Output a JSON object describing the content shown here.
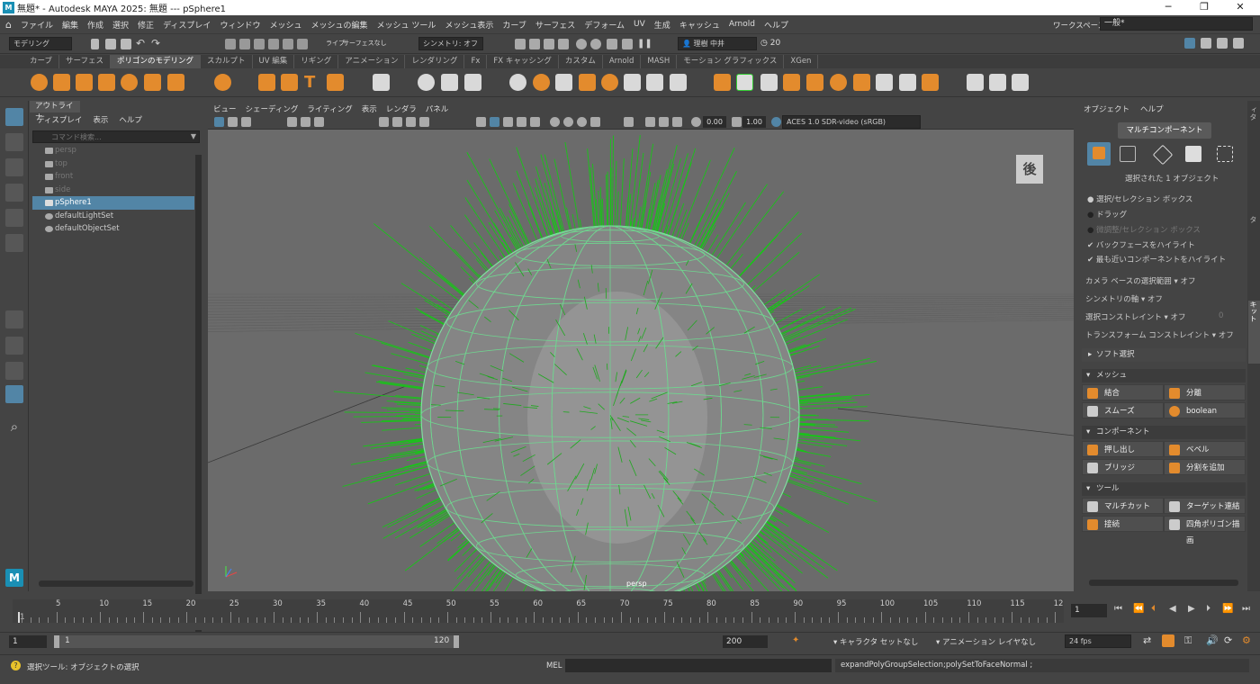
{
  "window": {
    "title": "無題* - Autodesk MAYA 2025: 無題   ---   pSphere1",
    "min": "─",
    "max": "❐",
    "close": "✕"
  },
  "menu": [
    "ファイル",
    "編集",
    "作成",
    "選択",
    "修正",
    "ディスプレイ",
    "ウィンドウ",
    "メッシュ",
    "メッシュの編集",
    "メッシュ ツール",
    "メッシュ表示",
    "カーブ",
    "サーフェス",
    "デフォーム",
    "UV",
    "生成",
    "キャッシュ",
    "Arnold",
    "ヘルプ"
  ],
  "workspace": {
    "label": "ワークスペース:",
    "value": "一般*"
  },
  "status": {
    "mode": "モデリング",
    "live": "ライブ",
    "live_value": "サーフェスなし",
    "symmetry": "シンメトリ: オフ",
    "user": "理樹 中井",
    "notifications": "20"
  },
  "shelf_tabs": [
    "カーブ",
    "サーフェス",
    "ポリゴンのモデリング",
    "スカルプト",
    "UV 編集",
    "リギング",
    "アニメーション",
    "レンダリング",
    "Fx",
    "FX キャッシング",
    "カスタム",
    "Arnold",
    "MASH",
    "モーション グラフィックス",
    "XGen"
  ],
  "shelf_active": "ポリゴンのモデリング",
  "outliner": {
    "title": "アウトライナ",
    "menu": [
      "ディスプレイ",
      "表示",
      "ヘルプ"
    ],
    "search_placeholder": "コマンド検索...",
    "items": [
      {
        "label": "persp",
        "state": "dim"
      },
      {
        "label": "top",
        "state": "dim"
      },
      {
        "label": "front",
        "state": "dim"
      },
      {
        "label": "side",
        "state": "dim"
      },
      {
        "label": "pSphere1",
        "state": "sel"
      },
      {
        "label": "defaultLightSet",
        "state": "normal"
      },
      {
        "label": "defaultObjectSet",
        "state": "normal"
      }
    ]
  },
  "viewport": {
    "menu": [
      "ビュー",
      "シェーディング",
      "ライティング",
      "表示",
      "レンダラ",
      "パネル"
    ],
    "exposure": "0.00",
    "gamma": "1.00",
    "colorspace": "ACES 1.0 SDR-video (sRGB)",
    "camera_label": "persp",
    "viewcube_label": "後"
  },
  "tool_settings": {
    "menu": [
      "オブジェクト",
      "ヘルプ"
    ],
    "multi_component": "マルチコンポーネント",
    "selected_count": "選択された 1 オブジェクト",
    "options": [
      "選択/セレクション ボックス",
      "ドラッグ",
      "微調整/セレクション ボックス"
    ],
    "checks": [
      "バックフェースをハイライト",
      "最も近いコンポーネントをハイライト"
    ],
    "dropdowns": [
      {
        "label": "カメラ ベースの選択範囲",
        "value": "オフ"
      },
      {
        "label": "シンメトリの軸",
        "value": "オフ"
      },
      {
        "label": "選択コンストレイント",
        "value": "オフ",
        "extra": "0"
      },
      {
        "label": "トランスフォーム コンストレイント",
        "value": "オフ"
      }
    ],
    "soft_select": "ソフト選択",
    "sections": [
      {
        "title": "メッシュ",
        "buttons": [
          "結合",
          "分離",
          "スムーズ",
          "boolean"
        ]
      },
      {
        "title": "コンポーネント",
        "buttons": [
          "押し出し",
          "ベベル",
          "ブリッジ",
          "分割を追加"
        ]
      },
      {
        "title": "ツール",
        "buttons": [
          "マルチカット",
          "ターゲット連結",
          "接続",
          "四角ポリゴン描画"
        ]
      }
    ]
  },
  "side_tabs": [
    "チャネル ボックス/レイヤ エディタ",
    "アトリビュート エディタ",
    "モデリング ツールキット"
  ],
  "timeline": {
    "ticks": [
      "1",
      "5",
      "10",
      "15",
      "20",
      "25",
      "30",
      "35",
      "40",
      "45",
      "50",
      "55",
      "60",
      "65",
      "70",
      "75",
      "80",
      "85",
      "90",
      "95",
      "100",
      "105",
      "110",
      "115",
      "12"
    ],
    "current_frame": "1",
    "start": "1",
    "range_start": "1",
    "range_end": "120",
    "end": "200",
    "character_set": "キャラクタ セットなし",
    "anim_layer": "アニメーション レイヤなし",
    "fps": "24 fps"
  },
  "cmd": {
    "help": "選択ツール: オブジェクトの選択",
    "lang": "MEL",
    "result": "expandPolyGroupSelection;polySetToFaceNormal ;"
  }
}
